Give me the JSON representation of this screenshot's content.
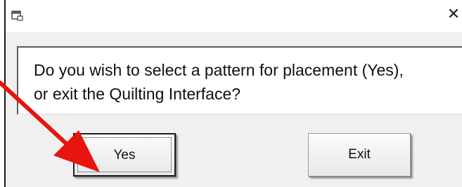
{
  "window": {
    "icon": "app-window-icon",
    "close_icon": "close-icon",
    "close_glyph": "✕"
  },
  "message": {
    "line1": "Do you wish to select a pattern for placement (Yes),",
    "line2": "or exit the Quilting Interface?"
  },
  "buttons": {
    "yes_label": "Yes",
    "exit_label": "Exit"
  },
  "annotation": {
    "arrow_color": "#e8140e",
    "arrow_target": "yes-button"
  }
}
